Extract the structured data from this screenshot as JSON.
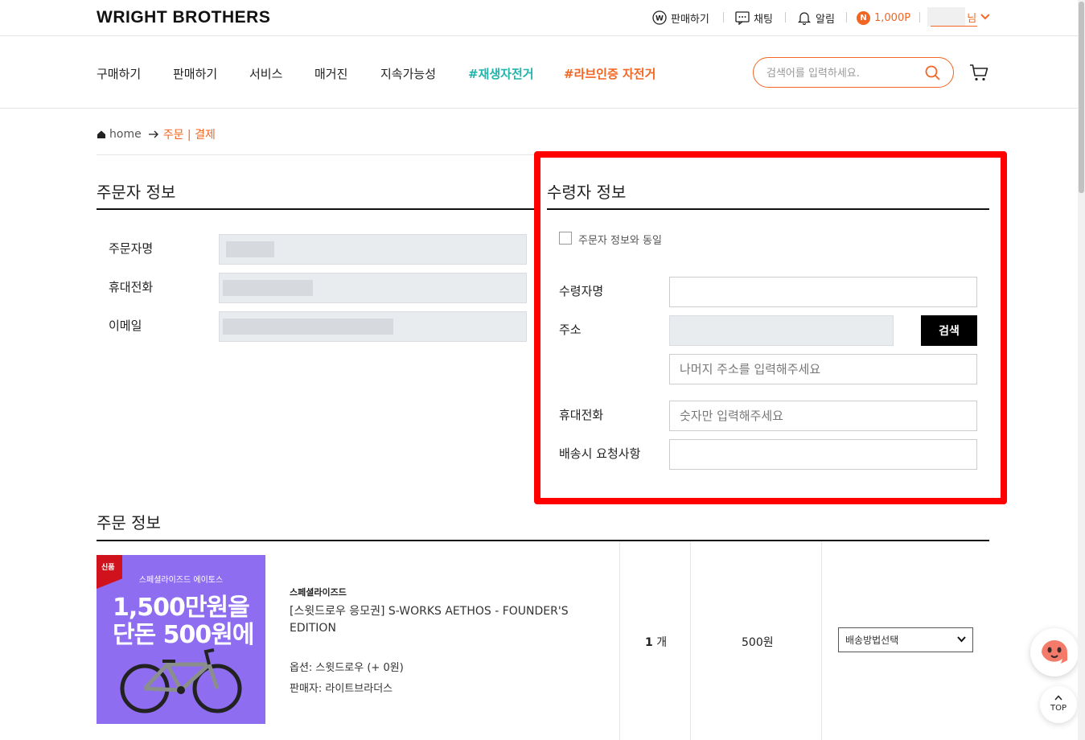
{
  "header": {
    "logo": "WRIGHT BROTHERS",
    "sell_label": "판매하기",
    "chat_label": "채팅",
    "alarm_label": "알림",
    "points_badge": "N",
    "points": "1,000P",
    "user_suffix": "님"
  },
  "nav": {
    "items": [
      "구매하기",
      "판매하기",
      "서비스",
      "매거진",
      "지속가능성"
    ],
    "tag_recycled": "#재생자전거",
    "tag_certified": "#라브인증 자전거",
    "search_placeholder": "검색어를 입력하세요."
  },
  "breadcrumb": {
    "home": "home",
    "current": "주문 | 결제"
  },
  "orderer": {
    "title": "주문자 정보",
    "name_label": "주문자명",
    "phone_label": "휴대전화",
    "email_label": "이메일"
  },
  "receiver": {
    "title": "수령자 정보",
    "same_label": "주문자 정보와 동일",
    "name_label": "수령자명",
    "address_label": "주소",
    "search_button": "검색",
    "address_detail_placeholder": "나머지 주소를 입력해주세요",
    "phone_label": "휴대전화",
    "phone_placeholder": "숫자만 입력해주세요",
    "request_label": "배송시 요청사항"
  },
  "order": {
    "title": "주문 정보",
    "thumbnail": {
      "new_tag": "신품",
      "subtitle": "스페셜라이즈드 에이토스",
      "line1": "1,500만원을",
      "line2": "단돈 500원에"
    },
    "brand": "스페셜라이즈드",
    "product_name": "[스윗드로우 응모권] S-WORKS AETHOS - FOUNDER'S EDITION",
    "option": "옵션: 스윗드로우 (+ 0원)",
    "seller": "판매자: 라이트브라더스",
    "quantity": "1",
    "quantity_unit": "개",
    "price": "500원",
    "shipping_select": "배송방법선택"
  },
  "floating": {
    "top_label": "TOP"
  },
  "colors": {
    "accent": "#f26522",
    "teal": "#1fb5ad",
    "highlight_box": "#ff0000"
  }
}
